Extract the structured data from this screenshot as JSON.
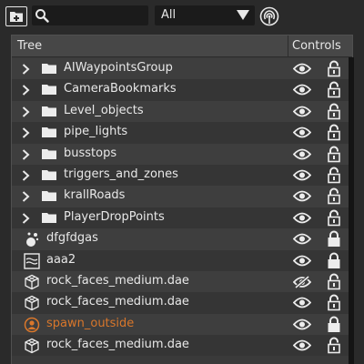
{
  "toolbar": {
    "new_folder_icon": "folder-plus-icon",
    "search": {
      "value": "",
      "placeholder": ""
    },
    "filter": {
      "selected": "All"
    },
    "broadcast_icon": "broadcast-icon"
  },
  "tree": {
    "header": {
      "tree_label": "Tree",
      "controls_label": "Controls"
    },
    "items": [
      {
        "label": "AIWaypointsGroup",
        "icon": "folder-icon",
        "expandable": true,
        "visible": true,
        "locked": false
      },
      {
        "label": "CameraBookmarks",
        "icon": "folder-icon",
        "expandable": true,
        "visible": true,
        "locked": false
      },
      {
        "label": "Level_objects",
        "icon": "folder-icon",
        "expandable": true,
        "visible": true,
        "locked": false
      },
      {
        "label": "pipe_lights",
        "icon": "folder-icon",
        "expandable": true,
        "visible": true,
        "locked": false
      },
      {
        "label": "busstops",
        "icon": "folder-icon",
        "expandable": true,
        "visible": true,
        "locked": false
      },
      {
        "label": "triggers_and_zones",
        "icon": "folder-icon",
        "expandable": true,
        "visible": true,
        "locked": false
      },
      {
        "label": "krallRoads",
        "icon": "folder-icon",
        "expandable": true,
        "visible": true,
        "locked": false
      },
      {
        "label": "PlayerDropPoints",
        "icon": "folder-icon",
        "expandable": true,
        "visible": true,
        "locked": false
      },
      {
        "label": "dfgfdgas",
        "icon": "particle-emitter-icon",
        "expandable": false,
        "visible": true,
        "locked": true
      },
      {
        "label": "aaa2",
        "icon": "water-plane-icon",
        "expandable": false,
        "visible": true,
        "locked": true
      },
      {
        "label": "rock_faces_medium.dae",
        "icon": "mesh-cube-icon",
        "expandable": false,
        "visible": false,
        "locked": false
      },
      {
        "label": "rock_faces_medium.dae",
        "icon": "mesh-cube-icon",
        "expandable": false,
        "visible": true,
        "locked": false
      },
      {
        "label": "spawn_outside",
        "icon": "spawn-point-icon",
        "expandable": false,
        "visible": true,
        "locked": true,
        "highlight": true
      },
      {
        "label": "rock_faces_medium.dae",
        "icon": "mesh-cube-icon",
        "expandable": false,
        "visible": true,
        "locked": false
      }
    ]
  },
  "colors": {
    "background": "#2a2a2a",
    "panel": "#3a3a3a",
    "header": "#474747",
    "text": "#e8e8e8",
    "highlight_text": "#d9772b"
  }
}
